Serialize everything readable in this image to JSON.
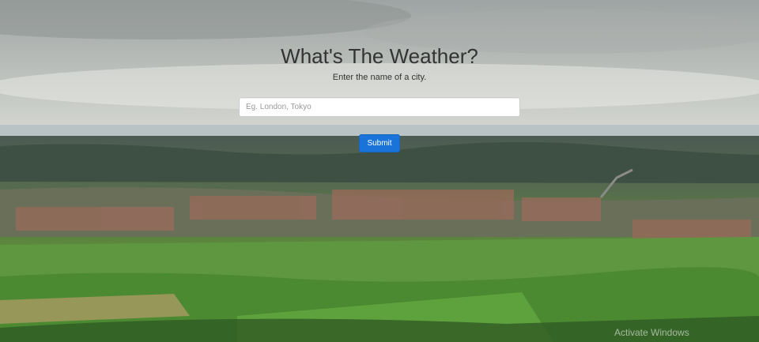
{
  "header": {
    "title": "What's The Weather?",
    "subtitle": "Enter the name of a city."
  },
  "search": {
    "placeholder": "Eg. London, Tokyo",
    "value": ""
  },
  "form": {
    "submit_label": "Submit"
  },
  "watermark": {
    "text": "Activate Windows"
  },
  "colors": {
    "accent": "#1a73d9",
    "title_text": "#333333"
  }
}
